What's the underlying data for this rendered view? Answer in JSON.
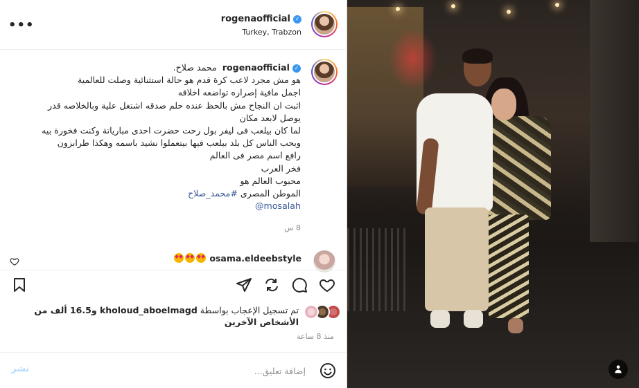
{
  "header": {
    "username": "rogenaofficial",
    "location": "Turkey, Trabzon",
    "more_label": "•••"
  },
  "caption": {
    "username": "rogenaofficial",
    "lines": [
      "محمد صلاح.",
      "هو مش مجرد لاعب كرة قدم هو حالة استثنائية وصلت للعالمية",
      "اجمل مافية إصراره تواضعه اخلاقه",
      "اثبت ان النجاح مش بالحظ عنده حلم صدقه اشتغل علية وبالخلاصه قدر",
      "يوصل لابعد مكان",
      "لما كان بيلعب فى ليفر بول رحت حضرت احدى مبارياتة وكنت فخورة بيه",
      "وبحب الناس كل بلد بيلعب فيها بيتعملوا نشيد باسمه وهكذا طرابزون",
      "رافع اسم مصر فى العالم",
      "فخر العرب",
      "محبوب العالم هو"
    ],
    "hashtag_prefix": "الموطن المصرى ",
    "hashtag": "#محمد_صلاح",
    "mention": "@mosalah",
    "time": "8 س"
  },
  "comment": {
    "username": "osama.eldeebstyle",
    "emoji_count": 3
  },
  "likes": {
    "prefix": "تم تسجيل الإعجاب بواسطة ",
    "liker": "kholoud_aboelmagd",
    "suffix": " و16.5 ألف من",
    "line2": "الأشخاص الآخرين",
    "ago": "منذ 8 ساعة"
  },
  "composer": {
    "placeholder": "إضافة تعليق...",
    "post_label": "نشر"
  },
  "colors": {
    "link": "#385898",
    "verified": "#3897f0",
    "post_disabled": "#b3dbff",
    "muted": "#8e8e8e"
  },
  "icons": [
    "more-icon",
    "verified-icon",
    "heart-icon",
    "comment-icon",
    "share-icon",
    "send-icon",
    "bookmark-icon",
    "smiley-icon",
    "mute-icon"
  ]
}
